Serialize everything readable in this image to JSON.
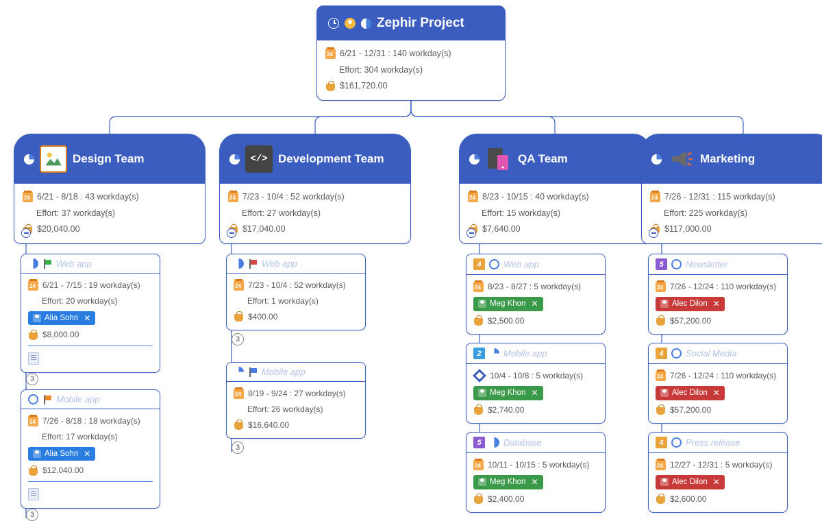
{
  "root": {
    "title": "Zephir Project",
    "dates": "6/21 - 12/31 : 140 workday(s)",
    "effort": "Effort: 304 workday(s)",
    "cost": "$161,720.00"
  },
  "teams": [
    {
      "name": "Design Team",
      "icon": "design",
      "dates": "6/21 - 8/18 : 43 workday(s)",
      "effort": "Effort: 37 workday(s)",
      "cost": "$20,040.00",
      "tasks": [
        {
          "title": "Web app",
          "flag": "green",
          "pie": "p50",
          "dates": "6/21 - 7/15 : 19 workday(s)",
          "effort": "Effort: 20 workday(s)",
          "assignee": "Alia Sohn",
          "assignee_color": "blue",
          "cost": "$8,000.00",
          "has_note": true,
          "child_count": "3"
        },
        {
          "title": "Mobile app",
          "flag": "orange",
          "pie": "p0",
          "dates": "7/26 - 8/18 : 18 workday(s)",
          "effort": "Effort: 17 workday(s)",
          "assignee": "Alia Sohn",
          "assignee_color": "blue",
          "cost": "$12,040.00",
          "has_note": true,
          "child_count": "3"
        }
      ]
    },
    {
      "name": "Development Team",
      "icon": "dev",
      "dates": "7/23 - 10/4 : 52 workday(s)",
      "effort": "Effort: 27 workday(s)",
      "cost": "$17,040.00",
      "tasks": [
        {
          "title": "Web app",
          "flag": "red",
          "pie": "p50",
          "dates": "7/23 - 10/4 : 52 workday(s)",
          "effort": "Effort: 1 workday(s)",
          "cost": "$400.00",
          "child_count": "3"
        },
        {
          "title": "Mobile app",
          "flag": "blue",
          "pie": "p25",
          "dates": "8/19 - 9/24 : 27 workday(s)",
          "effort": "Effort: 26 workday(s)",
          "cost": "$16,640.00",
          "child_count": "3"
        }
      ]
    },
    {
      "name": "QA Team",
      "icon": "qa",
      "dates": "8/23 - 10/15 : 40 workday(s)",
      "effort": "Effort: 15 workday(s)",
      "cost": "$7,640.00",
      "tasks": [
        {
          "title": "Web app",
          "badge": "4",
          "pie": "p0",
          "dates": "8/23 - 8/27 : 5 workday(s)",
          "assignee": "Meg Khon",
          "assignee_color": "green",
          "cost": "$2,500.00"
        },
        {
          "title": "Mobile app",
          "badge": "2",
          "pie": "p25",
          "show_diamond": true,
          "dates": "10/4 - 10/8 : 5 workday(s)",
          "assignee": "Meg Khon",
          "assignee_color": "green",
          "cost": "$2,740.00"
        },
        {
          "title": "Database",
          "badge": "5",
          "pie": "p50",
          "dates": "10/11 - 10/15 : 5 workday(s)",
          "assignee": "Meg Khon",
          "assignee_color": "green",
          "cost": "$2,400.00"
        }
      ]
    },
    {
      "name": "Marketing",
      "icon": "market",
      "dates": "7/26 - 12/31 : 115 workday(s)",
      "effort": "Effort: 225 workday(s)",
      "cost": "$117,000.00",
      "tasks": [
        {
          "title": "Newsletter",
          "badge": "5",
          "pie": "p0",
          "dates": "7/26 - 12/24 : 110 workday(s)",
          "assignee": "Alec Dilon",
          "assignee_color": "red",
          "cost": "$57,200.00"
        },
        {
          "title": "Social Media",
          "badge": "4",
          "pie": "p0",
          "dates": "7/26 - 12/24 : 110 workday(s)",
          "assignee": "Alec Dilon",
          "assignee_color": "red",
          "cost": "$57,200.00"
        },
        {
          "title": "Press release",
          "badge": "4",
          "pie": "p0",
          "dates": "12/27 - 12/31 : 5 workday(s)",
          "assignee": "Alec Dilon",
          "assignee_color": "red",
          "cost": "$2,600.00"
        }
      ]
    }
  ]
}
